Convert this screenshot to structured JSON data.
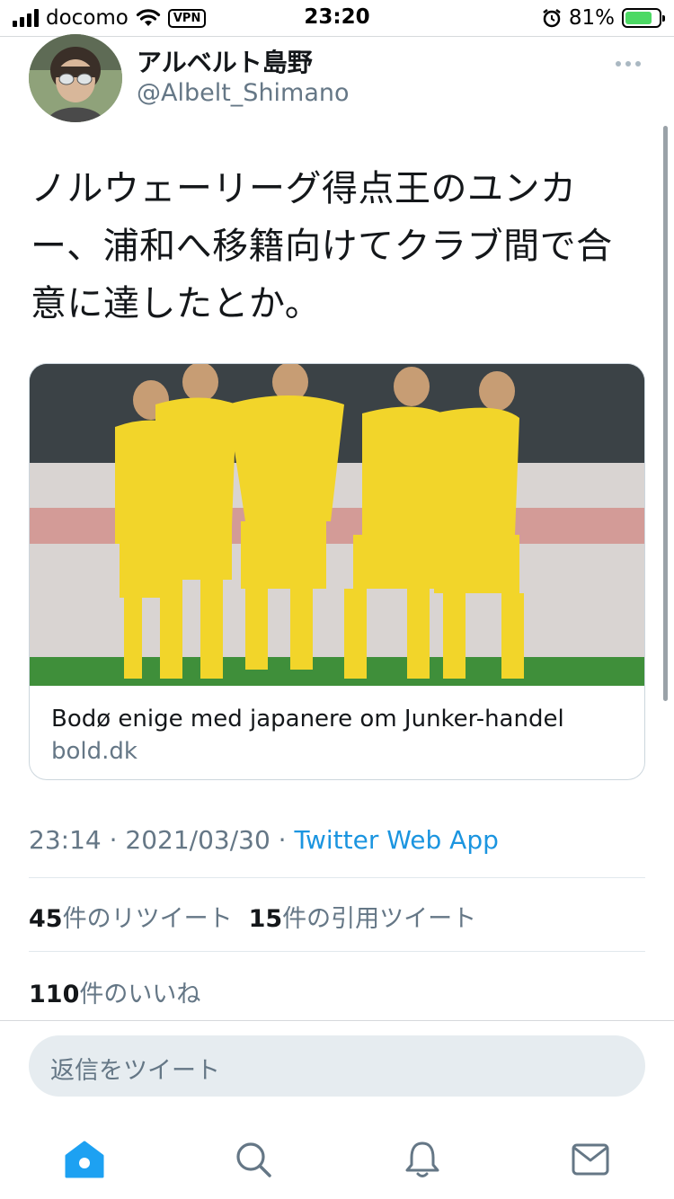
{
  "status_bar": {
    "carrier": "docomo",
    "vpn": "VPN",
    "time": "23:20",
    "battery_percent": "81%",
    "battery_level": 0.81,
    "icons": [
      "signal-icon",
      "wifi-icon",
      "alarm-icon",
      "battery-charging-icon"
    ]
  },
  "tweet": {
    "display_name": "アルベルト島野",
    "handle": "@Albelt_Shimano",
    "more_icon": "more-icon",
    "text": "ノルウェーリーグ得点王のユンカー、浦和へ移籍向けてクラブ間で合意に達したとか。",
    "card": {
      "title": "Bodø enige med japanere om Junker-handel",
      "domain": "bold.dk"
    },
    "timestamp": "23:14 · 2021/03/30 · ",
    "source": "Twitter Web App",
    "retweets_count": "45",
    "retweets_label": "件のリツイート",
    "quotes_count": "15",
    "quotes_label": "件の引用ツイート",
    "likes_count": "110",
    "likes_label": "件のいいね"
  },
  "reply": {
    "placeholder": "返信をツイート"
  },
  "tab_bar": {
    "tabs": [
      "home-icon",
      "search-icon",
      "notifications-icon",
      "messages-icon"
    ],
    "active": "home-icon",
    "accent_color": "#1da1f2"
  }
}
